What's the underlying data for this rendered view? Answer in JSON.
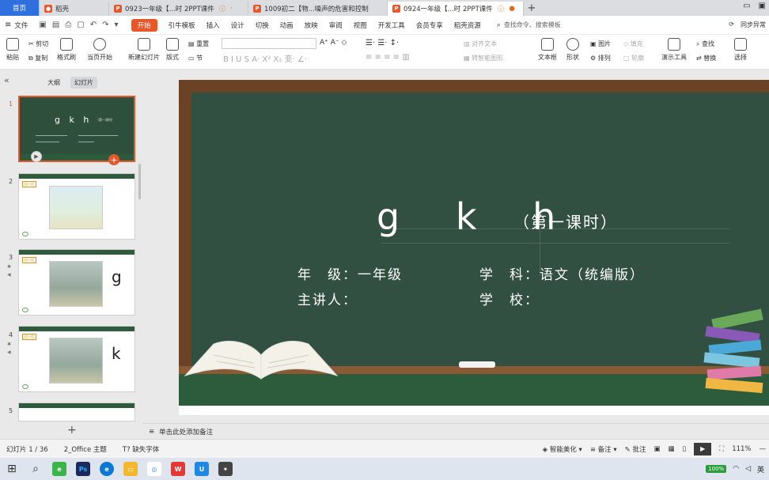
{
  "tabs": [
    {
      "label": "首页",
      "kind": "home"
    },
    {
      "label": "稻壳",
      "kind": "normal",
      "icon": "docer-icon",
      "color": "#e8572a"
    },
    {
      "label": "0923一年级【...时 2PPT课件",
      "kind": "normal",
      "icon": "ppt-file-icon",
      "color": "#e8572a",
      "status": "warning"
    },
    {
      "label": "1009初二【物...噪声的危害和控制",
      "kind": "normal",
      "icon": "ppt-file-icon",
      "color": "#e8572a",
      "status": "close"
    },
    {
      "label": "0924一年级【...时 2PPT课件",
      "kind": "active",
      "icon": "ppt-file-icon",
      "color": "#e8572a",
      "status": "warning-dot"
    }
  ],
  "menu": {
    "file": "文件",
    "items": [
      "开始",
      "引牛模板",
      "插入",
      "设计",
      "切换",
      "动画",
      "放映",
      "审阅",
      "视图",
      "开发工具",
      "会员专享",
      "稻壳资源"
    ],
    "search": "查找命令、搜索模板",
    "sync": "同步异常"
  },
  "ribbon": {
    "paste": "粘贴",
    "cut": "剪切",
    "copy": "复制",
    "format_painter": "格式刷",
    "from_current": "当页开始",
    "new_slide": "新建幻灯片",
    "layout": "版式",
    "section": "节",
    "reset": "重置",
    "textbox": "文本框",
    "shape": "形状",
    "picture": "图片",
    "arrange": "排列",
    "fill": "填充",
    "outline": "轮廓",
    "present_tools": "演示工具",
    "find": "查找",
    "replace": "替换",
    "select": "选择",
    "align_text": "对齐文本",
    "smartart": "转智能图形"
  },
  "left_panel": {
    "tab_outline": "大纲",
    "tab_slides": "幻灯片",
    "thumbs": [
      {
        "num": "1",
        "selected": true,
        "title": "g k h",
        "subtitle": "（第一课时）"
      },
      {
        "num": "2",
        "selected": false,
        "label": "比一比"
      },
      {
        "num": "3",
        "selected": false,
        "label": "比一比",
        "letter": "g"
      },
      {
        "num": "4",
        "selected": false,
        "label": "比一比",
        "letter": "k"
      },
      {
        "num": "5",
        "selected": false
      }
    ]
  },
  "slide": {
    "title": "g k h",
    "lesson": "（第一课时）",
    "grade": "年　级：一年级",
    "subject": "学　科：语文（统编版）",
    "speaker": "主讲人：",
    "school": "学　校："
  },
  "notes": {
    "placeholder": "单击此处添加备注"
  },
  "status": {
    "slide_count": "幻灯片 1 / 36",
    "theme": "2_Office 主题",
    "missing_font": "缺失字体",
    "smart_beautify": "智能美化",
    "notes": "备注",
    "comments": "批注",
    "zoom": "111%"
  },
  "taskbar": {
    "battery": "100%",
    "lang": "英"
  }
}
